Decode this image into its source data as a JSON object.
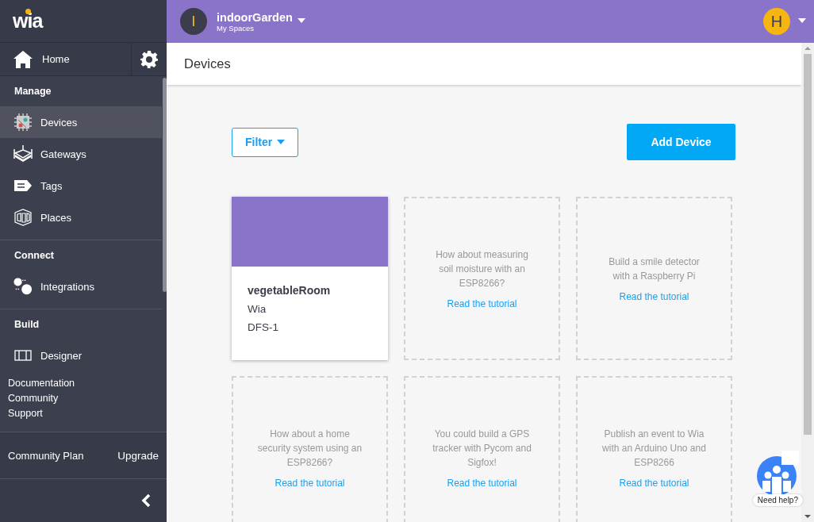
{
  "logo": "wia",
  "space": {
    "initial": "I",
    "name": "indoorGarden",
    "subtitle": "My Spaces"
  },
  "user": {
    "initial": "H"
  },
  "sidebar": {
    "home": "Home",
    "sections": [
      {
        "title": "Manage",
        "items": [
          {
            "label": "Devices",
            "selected": true
          },
          {
            "label": "Gateways",
            "selected": false
          },
          {
            "label": "Tags",
            "selected": false
          },
          {
            "label": "Places",
            "selected": false
          }
        ]
      },
      {
        "title": "Connect",
        "items": [
          {
            "label": "Integrations",
            "selected": false
          }
        ]
      },
      {
        "title": "Build",
        "items": [
          {
            "label": "Designer",
            "selected": false
          }
        ]
      }
    ],
    "links": [
      "Documentation",
      "Community",
      "Support"
    ],
    "plan": "Community Plan",
    "upgrade": "Upgrade"
  },
  "page_title": "Devices",
  "filter_button": "Filter",
  "add_button": "Add Device",
  "cards": [
    {
      "kind": "device",
      "name": "vegetableRoom",
      "maker": "Wia",
      "model": "DFS-1"
    },
    {
      "kind": "tutorial",
      "text": "How about measuring soil moisture with an ESP8266?",
      "link": "Read the tutorial"
    },
    {
      "kind": "tutorial",
      "text": "Build a smile detector with a Raspberry Pi",
      "link": "Read the tutorial"
    },
    {
      "kind": "tutorial",
      "text": "How about a home security system using an ESP8266?",
      "link": "Read the tutorial"
    },
    {
      "kind": "tutorial",
      "text": "You could build a GPS tracker with Pycom and Sigfox!",
      "link": "Read the tutorial"
    },
    {
      "kind": "tutorial",
      "text": "Publish an event to Wia with an Arduino Uno and ESP8266",
      "link": "Read the tutorial"
    }
  ],
  "help": "Need help?"
}
